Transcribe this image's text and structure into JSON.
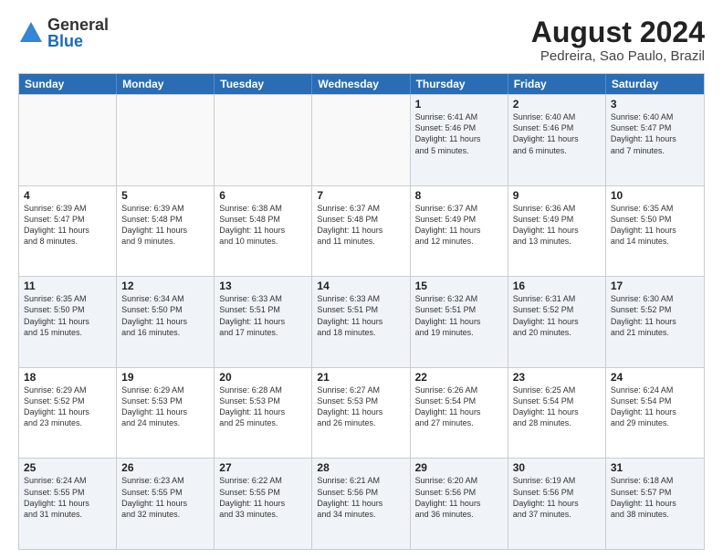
{
  "logo": {
    "general": "General",
    "blue": "Blue"
  },
  "title": "August 2024",
  "subtitle": "Pedreira, Sao Paulo, Brazil",
  "days": [
    "Sunday",
    "Monday",
    "Tuesday",
    "Wednesday",
    "Thursday",
    "Friday",
    "Saturday"
  ],
  "rows": [
    [
      {
        "day": "",
        "info": ""
      },
      {
        "day": "",
        "info": ""
      },
      {
        "day": "",
        "info": ""
      },
      {
        "day": "",
        "info": ""
      },
      {
        "day": "1",
        "info": "Sunrise: 6:41 AM\nSunset: 5:46 PM\nDaylight: 11 hours\nand 5 minutes."
      },
      {
        "day": "2",
        "info": "Sunrise: 6:40 AM\nSunset: 5:46 PM\nDaylight: 11 hours\nand 6 minutes."
      },
      {
        "day": "3",
        "info": "Sunrise: 6:40 AM\nSunset: 5:47 PM\nDaylight: 11 hours\nand 7 minutes."
      }
    ],
    [
      {
        "day": "4",
        "info": "Sunrise: 6:39 AM\nSunset: 5:47 PM\nDaylight: 11 hours\nand 8 minutes."
      },
      {
        "day": "5",
        "info": "Sunrise: 6:39 AM\nSunset: 5:48 PM\nDaylight: 11 hours\nand 9 minutes."
      },
      {
        "day": "6",
        "info": "Sunrise: 6:38 AM\nSunset: 5:48 PM\nDaylight: 11 hours\nand 10 minutes."
      },
      {
        "day": "7",
        "info": "Sunrise: 6:37 AM\nSunset: 5:48 PM\nDaylight: 11 hours\nand 11 minutes."
      },
      {
        "day": "8",
        "info": "Sunrise: 6:37 AM\nSunset: 5:49 PM\nDaylight: 11 hours\nand 12 minutes."
      },
      {
        "day": "9",
        "info": "Sunrise: 6:36 AM\nSunset: 5:49 PM\nDaylight: 11 hours\nand 13 minutes."
      },
      {
        "day": "10",
        "info": "Sunrise: 6:35 AM\nSunset: 5:50 PM\nDaylight: 11 hours\nand 14 minutes."
      }
    ],
    [
      {
        "day": "11",
        "info": "Sunrise: 6:35 AM\nSunset: 5:50 PM\nDaylight: 11 hours\nand 15 minutes."
      },
      {
        "day": "12",
        "info": "Sunrise: 6:34 AM\nSunset: 5:50 PM\nDaylight: 11 hours\nand 16 minutes."
      },
      {
        "day": "13",
        "info": "Sunrise: 6:33 AM\nSunset: 5:51 PM\nDaylight: 11 hours\nand 17 minutes."
      },
      {
        "day": "14",
        "info": "Sunrise: 6:33 AM\nSunset: 5:51 PM\nDaylight: 11 hours\nand 18 minutes."
      },
      {
        "day": "15",
        "info": "Sunrise: 6:32 AM\nSunset: 5:51 PM\nDaylight: 11 hours\nand 19 minutes."
      },
      {
        "day": "16",
        "info": "Sunrise: 6:31 AM\nSunset: 5:52 PM\nDaylight: 11 hours\nand 20 minutes."
      },
      {
        "day": "17",
        "info": "Sunrise: 6:30 AM\nSunset: 5:52 PM\nDaylight: 11 hours\nand 21 minutes."
      }
    ],
    [
      {
        "day": "18",
        "info": "Sunrise: 6:29 AM\nSunset: 5:52 PM\nDaylight: 11 hours\nand 23 minutes."
      },
      {
        "day": "19",
        "info": "Sunrise: 6:29 AM\nSunset: 5:53 PM\nDaylight: 11 hours\nand 24 minutes."
      },
      {
        "day": "20",
        "info": "Sunrise: 6:28 AM\nSunset: 5:53 PM\nDaylight: 11 hours\nand 25 minutes."
      },
      {
        "day": "21",
        "info": "Sunrise: 6:27 AM\nSunset: 5:53 PM\nDaylight: 11 hours\nand 26 minutes."
      },
      {
        "day": "22",
        "info": "Sunrise: 6:26 AM\nSunset: 5:54 PM\nDaylight: 11 hours\nand 27 minutes."
      },
      {
        "day": "23",
        "info": "Sunrise: 6:25 AM\nSunset: 5:54 PM\nDaylight: 11 hours\nand 28 minutes."
      },
      {
        "day": "24",
        "info": "Sunrise: 6:24 AM\nSunset: 5:54 PM\nDaylight: 11 hours\nand 29 minutes."
      }
    ],
    [
      {
        "day": "25",
        "info": "Sunrise: 6:24 AM\nSunset: 5:55 PM\nDaylight: 11 hours\nand 31 minutes."
      },
      {
        "day": "26",
        "info": "Sunrise: 6:23 AM\nSunset: 5:55 PM\nDaylight: 11 hours\nand 32 minutes."
      },
      {
        "day": "27",
        "info": "Sunrise: 6:22 AM\nSunset: 5:55 PM\nDaylight: 11 hours\nand 33 minutes."
      },
      {
        "day": "28",
        "info": "Sunrise: 6:21 AM\nSunset: 5:56 PM\nDaylight: 11 hours\nand 34 minutes."
      },
      {
        "day": "29",
        "info": "Sunrise: 6:20 AM\nSunset: 5:56 PM\nDaylight: 11 hours\nand 36 minutes."
      },
      {
        "day": "30",
        "info": "Sunrise: 6:19 AM\nSunset: 5:56 PM\nDaylight: 11 hours\nand 37 minutes."
      },
      {
        "day": "31",
        "info": "Sunrise: 6:18 AM\nSunset: 5:57 PM\nDaylight: 11 hours\nand 38 minutes."
      }
    ]
  ]
}
